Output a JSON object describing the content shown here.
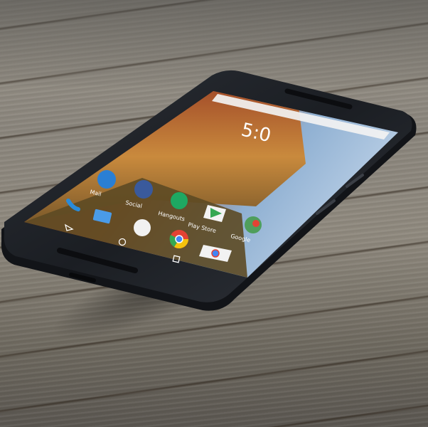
{
  "homescreen": {
    "clock": "5:0",
    "apps": [
      {
        "label": "Mail",
        "icon": "mail-icon"
      },
      {
        "label": "Social",
        "icon": "facebook-icon"
      },
      {
        "label": "Hangouts",
        "icon": "hangouts-icon"
      },
      {
        "label": "Play Store",
        "icon": "play-store-icon"
      },
      {
        "label": "Google",
        "icon": "google-maps-icon"
      }
    ],
    "dock": [
      {
        "icon": "phone-icon"
      },
      {
        "icon": "messages-icon"
      },
      {
        "icon": "app-drawer-icon"
      },
      {
        "icon": "chrome-icon"
      },
      {
        "icon": "camera-icon"
      }
    ],
    "nav": [
      {
        "icon": "back-icon"
      },
      {
        "icon": "home-icon"
      },
      {
        "icon": "recents-icon"
      }
    ]
  },
  "colors": {
    "phone_body": "#1c1f24",
    "wood": "#8f897e",
    "wallpaper_sky": "#9bb6d6",
    "wallpaper_rock": "#b3532a"
  }
}
